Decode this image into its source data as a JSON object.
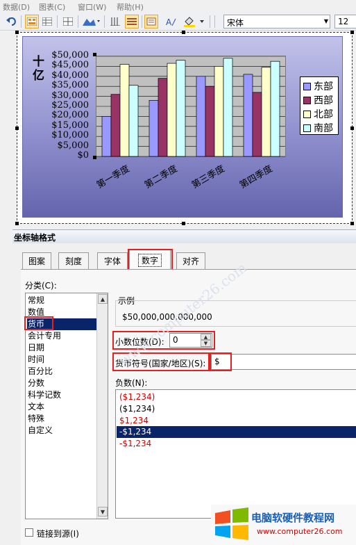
{
  "menu": [
    "数据(D)",
    "图表(C)",
    "窗口(W)",
    "帮助(H)"
  ],
  "toolbar": {
    "font_name": "宋体",
    "font_size": "12"
  },
  "chart": {
    "y_unit_label": [
      "十",
      "亿"
    ]
  },
  "chart_data": {
    "type": "bar",
    "categories": [
      "第一季度",
      "第二季度",
      "第三季度",
      "第四季度"
    ],
    "series": [
      {
        "name": "东部",
        "values": [
          20000,
          28000,
          40000,
          41000
        ],
        "color": "#9999ff"
      },
      {
        "name": "西部",
        "values": [
          31000,
          39000,
          35000,
          32000
        ],
        "color": "#993366"
      },
      {
        "name": "北部",
        "values": [
          46000,
          46500,
          45000,
          44500
        ],
        "color": "#ffffcc"
      },
      {
        "name": "南部",
        "values": [
          35500,
          48000,
          49000,
          47500
        ],
        "color": "#ccffff"
      }
    ],
    "y_ticks": [
      "$50,000",
      "$45,000",
      "$40,000",
      "$35,000",
      "$30,000",
      "$25,000",
      "$20,000",
      "$15,000",
      "$10,000",
      "$5,000",
      "$0"
    ],
    "ylim": [
      0,
      50000
    ],
    "grid": true,
    "legend_position": "right"
  },
  "dialog": {
    "title": "坐标轴格式",
    "tabs": [
      "图案",
      "刻度",
      "字体",
      "数字",
      "对齐"
    ],
    "category_label": "分类(C):",
    "categories": [
      "常规",
      "数值",
      "货币",
      "会计专用",
      "日期",
      "时间",
      "百分比",
      "分数",
      "科学记数",
      "文本",
      "特殊",
      "自定义"
    ],
    "sample_label": "示例",
    "sample_value": "$50,000,000,000,000",
    "decimal_label": "小数位数(D):",
    "decimal_value": "0",
    "symbol_label": "货币符号(国家/地区)(S):",
    "symbol_value": "$",
    "negative_label": "负数(N):",
    "negative_options": [
      "($1,234)",
      "($1,234)",
      "$1,234",
      "-$1,234",
      "-$1,234"
    ],
    "link_label": "链接到源(I)"
  },
  "watermark": "电脑软硬件教程网",
  "watermark_url": "www.computer26.com",
  "colors": {
    "accent_red": "#e62020",
    "selection": "#0a246a"
  }
}
